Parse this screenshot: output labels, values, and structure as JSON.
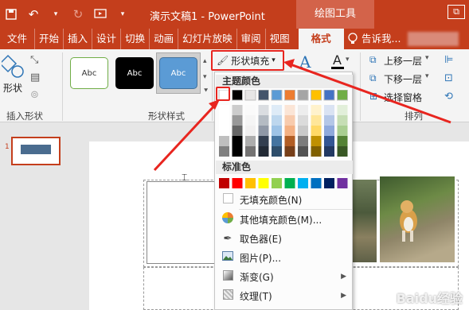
{
  "window": {
    "document_title": "演示文稿1 - PowerPoint",
    "context_tab_title": "绘图工具",
    "restore_glyph": "⧉"
  },
  "tabs": [
    "文件",
    "开始",
    "插入",
    "设计",
    "切换",
    "动画",
    "幻灯片放映",
    "审阅",
    "视图"
  ],
  "active_tab": "格式",
  "tell_me": "告诉我...",
  "ribbon": {
    "edit_shape_label": "形状",
    "insert_shapes_group": "插入形状",
    "shape_styles_group": "形状样式",
    "shape_style_sample": "Abc",
    "shape_fill_button": "形状填充",
    "bring_forward": "上移一层",
    "send_backward": "下移一层",
    "selection_pane": "选择窗格",
    "arrange_group": "排列",
    "font_a": "A"
  },
  "slide_panel": {
    "slide_number": "1"
  },
  "dropdown": {
    "theme_colors_header": "主题颜色",
    "standard_colors_header": "标准色",
    "theme_colors": [
      "#ffffff",
      "#000000",
      "#e7e6e6",
      "#44546a",
      "#5b9bd5",
      "#ed7d31",
      "#a5a5a5",
      "#ffc000",
      "#4472c4",
      "#70ad47"
    ],
    "standard_colors": [
      "#c00000",
      "#ff0000",
      "#ffc000",
      "#ffff00",
      "#92d050",
      "#00b050",
      "#00b0f0",
      "#0070c0",
      "#002060",
      "#7030a0"
    ],
    "items": [
      {
        "label": "无填充颜色(N)",
        "icon": "no-fill-icon",
        "submenu": false
      },
      {
        "label": "其他填充颜色(M)...",
        "icon": "color-wheel-icon",
        "submenu": false
      },
      {
        "label": "取色器(E)",
        "icon": "eyedropper-icon",
        "submenu": false
      },
      {
        "label": "图片(P)...",
        "icon": "picture-icon",
        "submenu": false
      },
      {
        "label": "渐变(G)",
        "icon": "gradient-icon",
        "submenu": true
      },
      {
        "label": "纹理(T)",
        "icon": "texture-icon",
        "submenu": true
      }
    ]
  },
  "colors": {
    "accent": "#c43e1c",
    "annotation": "#e8251f"
  },
  "watermark": "Baidu经验"
}
